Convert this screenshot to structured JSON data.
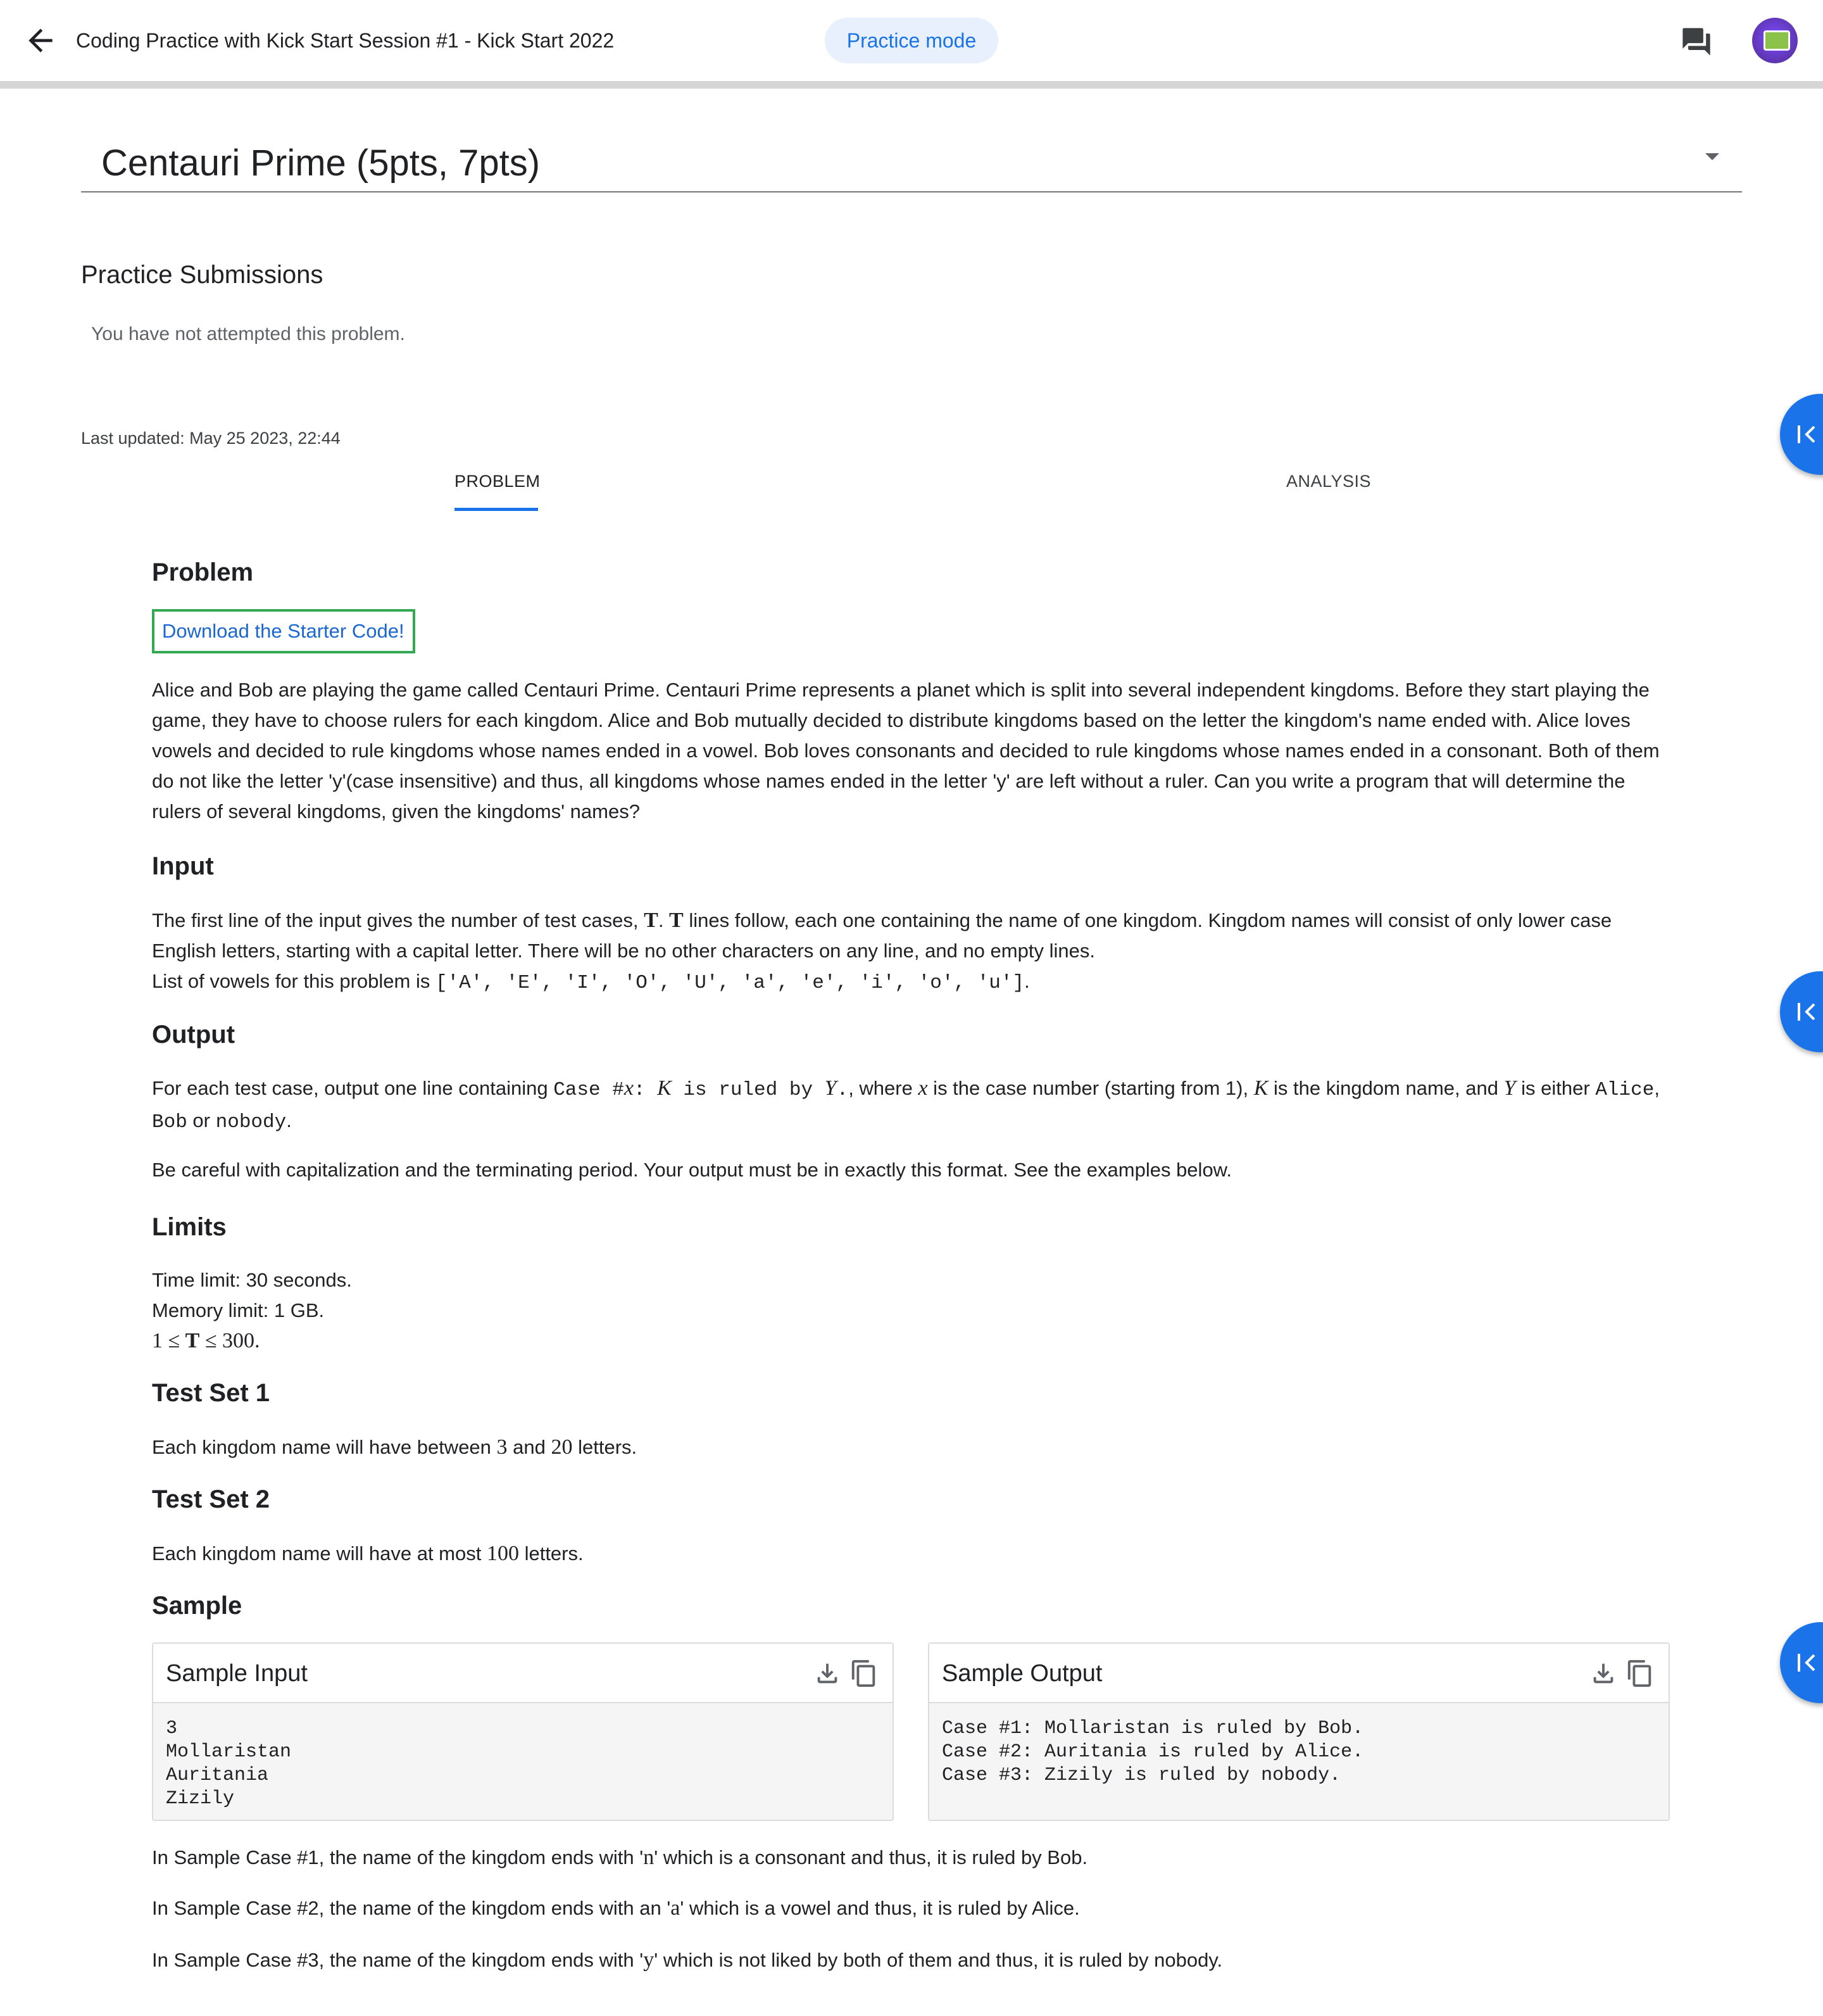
{
  "header": {
    "title": "Coding Practice with Kick Start Session #1 - Kick Start 2022",
    "mode_chip": "Practice mode",
    "icons": {
      "back": "arrow-back-icon",
      "chat": "chat-icon",
      "avatar": "user-avatar"
    },
    "accent_color": "#1a73e8"
  },
  "problem_select": {
    "value": "Centauri Prime (5pts, 7pts)"
  },
  "practice": {
    "title": "Practice Submissions",
    "status": "You have not attempted this problem."
  },
  "last_updated": "Last updated: May 25 2023, 22:44",
  "tabs": [
    {
      "label": "PROBLEM",
      "active": true
    },
    {
      "label": "ANALYSIS",
      "active": false
    }
  ],
  "problem": {
    "heading": "Problem",
    "starter_link": "Download the Starter Code!",
    "statement": "Alice and Bob are playing the game called Centauri Prime. Centauri Prime represents a planet which is split into several independent kingdoms. Before they start playing the game, they have to choose rulers for each kingdom. Alice and Bob mutually decided to distribute kingdoms based on the letter the kingdom's name ended with. Alice loves vowels and decided to rule kingdoms whose names ended in a vowel. Bob loves consonants and decided to rule kingdoms whose names ended in a consonant. Both of them do not like the letter 'y'(case insensitive) and thus, all kingdoms whose names ended in the letter 'y' are left without a ruler. Can you write a program that will determine the rulers of several kingdoms, given the kingdoms' names?"
  },
  "input": {
    "heading": "Input",
    "p1_a": "The first line of the input gives the number of test cases, ",
    "T": "T",
    "p1_b": ". ",
    "p1_c": " lines follow, each one containing the name of one kingdom. Kingdom names will consist of only lower case English letters, starting with a capital letter. There will be no other characters on any line, and no empty lines.",
    "p2_a": "List of vowels for this problem is ",
    "vowels": "['A', 'E', 'I', 'O', 'U', 'a', 'e', 'i', 'o', 'u']",
    "p2_b": "."
  },
  "output": {
    "heading": "Output",
    "p1_a": "For each test case, output one line containing ",
    "format_case": "Case #",
    "var_x": "x",
    "format_mid": ": ",
    "var_K": "K",
    "format_ruled": " is ruled by ",
    "var_Y": "Y",
    "format_end": ".",
    "p1_b": ", where ",
    "p1_c": " is the case number (starting from 1), ",
    "p1_d": " is the kingdom name, and ",
    "p1_e": " is either ",
    "alice": "Alice",
    "comma": ", ",
    "bob": "Bob",
    "or": " or ",
    "nobody": "nobody",
    "period": ".",
    "p2": "Be careful with capitalization and the terminating period. Your output must be in exactly this format. See the examples below."
  },
  "limits": {
    "heading": "Limits",
    "time": "Time limit: 30 seconds.",
    "memory": "Memory limit: 1 GB.",
    "constraint_a": "1 ≤ ",
    "constraint_T": "T",
    "constraint_b": " ≤ 300."
  },
  "test_set_1": {
    "heading": "Test Set 1",
    "a": "Each kingdom name will have between ",
    "n1": "3",
    "b": " and ",
    "n2": "20",
    "c": " letters."
  },
  "test_set_2": {
    "heading": "Test Set 2",
    "a": "Each kingdom name will have at most ",
    "n": "100",
    "b": " letters."
  },
  "sample": {
    "heading": "Sample",
    "input_title": "Sample Input",
    "input_text": "3\nMollaristan\nAuritania\nZizily",
    "output_title": "Sample Output",
    "output_text": "Case #1: Mollaristan is ruled by Bob.\nCase #2: Auritania is ruled by Alice.\nCase #3: Zizily is ruled by nobody.",
    "icons": {
      "download": "download-icon",
      "copy": "copy-icon"
    }
  },
  "explanations": [
    {
      "a": "In Sample Case #1, the name of the kingdom ends with '",
      "ch": "n",
      "b": "' which is a consonant and thus, it is ruled by Bob."
    },
    {
      "a": "In Sample Case #2, the name of the kingdom ends with an '",
      "ch": "a",
      "b": "' which is a vowel and thus, it is ruled by Alice."
    },
    {
      "a": "In Sample Case #3, the name of the kingdom ends with '",
      "ch": "y",
      "b": "' which is not liked by both of them and thus, it is ruled by nobody."
    }
  ]
}
